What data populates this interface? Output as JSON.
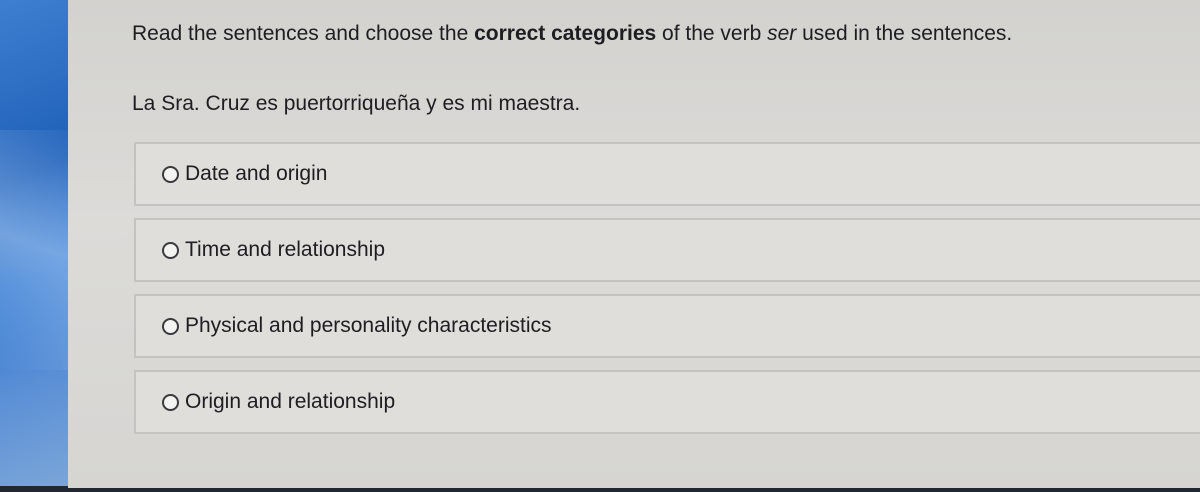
{
  "question": {
    "instruction_pre": "Read the sentences and choose the ",
    "instruction_bold": "correct categories",
    "instruction_mid": " of the verb ",
    "instruction_italic": "ser",
    "instruction_post": " used in the sentences.",
    "sentence": "La Sra. Cruz es puertorriqueña y es mi maestra."
  },
  "options": [
    {
      "label": "Date and origin",
      "selected": false
    },
    {
      "label": "Time and relationship",
      "selected": false
    },
    {
      "label": "Physical and personality characteristics",
      "selected": false
    },
    {
      "label": "Origin and relationship",
      "selected": false
    }
  ],
  "colors": {
    "panel_background": "#d8d7d4",
    "option_background": "#dfdedb",
    "text": "#1d1d22",
    "screen_edge": "#1e5fb8"
  }
}
